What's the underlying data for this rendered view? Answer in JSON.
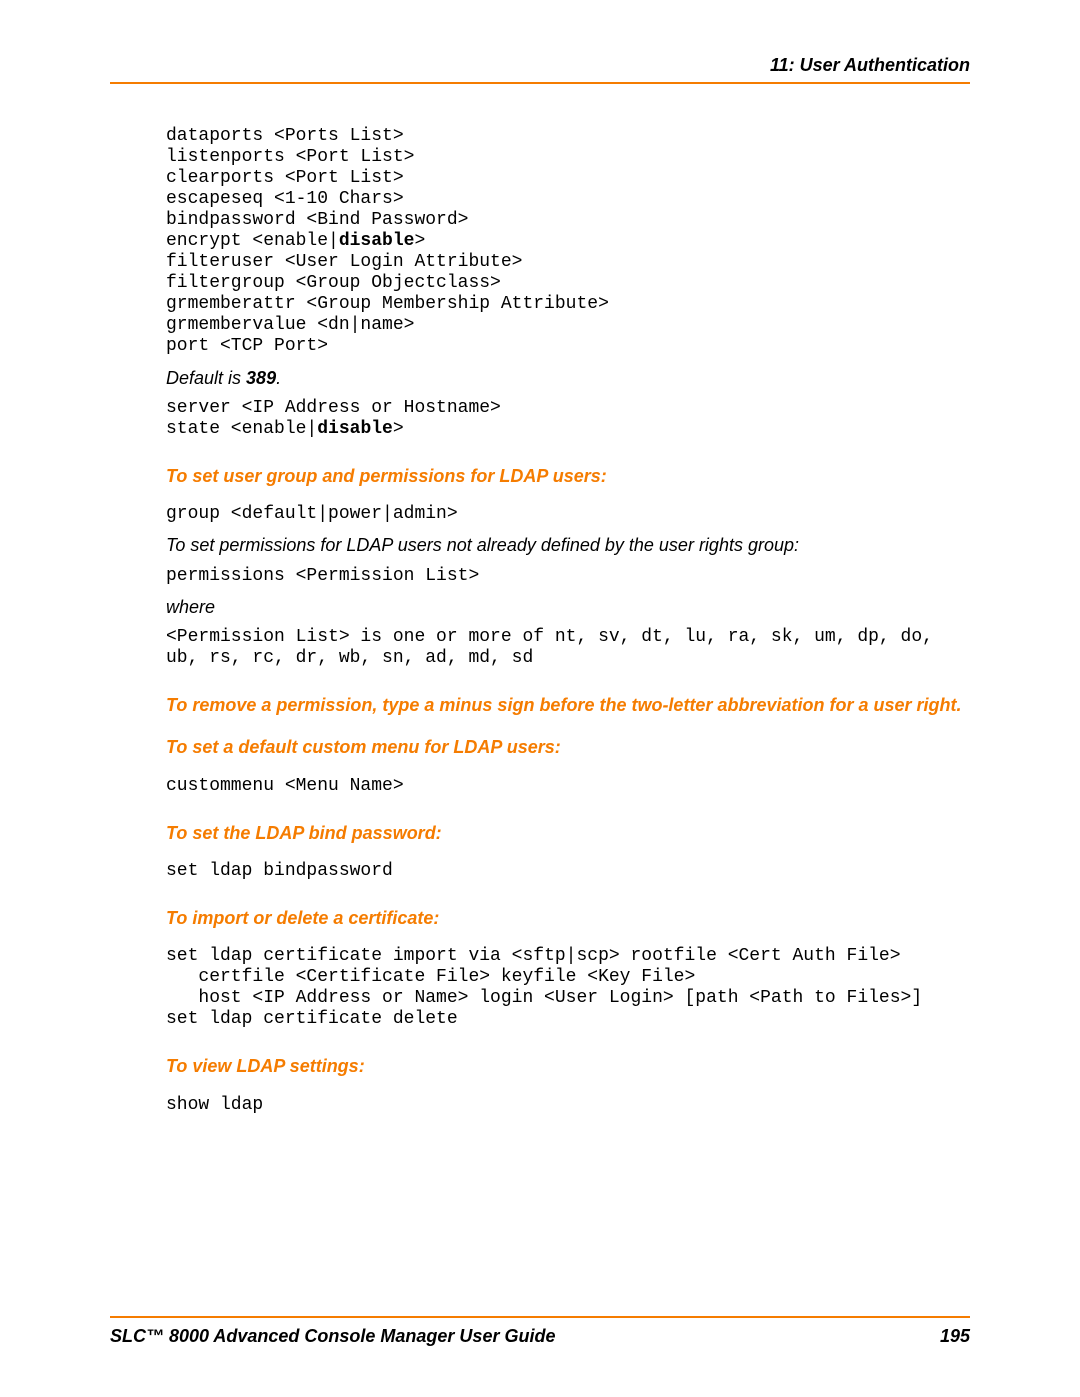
{
  "header": {
    "chapter": "11: User Authentication"
  },
  "code1_lines": [
    "dataports <Ports List>",
    "listenports <Port List>",
    "clearports <Port List>",
    "escapeseq <1-10 Chars>",
    "bindpassword <Bind Password>"
  ],
  "code1_encrypt_pre": "encrypt <enable|",
  "code1_encrypt_bold": "disable",
  "code1_encrypt_post": ">",
  "code1_tail": [
    "filteruser <User Login Attribute>",
    "filtergroup <Group Objectclass>",
    "grmemberattr <Group Membership Attribute>",
    "grmembervalue <dn|name>",
    "port <TCP Port>"
  ],
  "default_pre": "Default is ",
  "default_bold": "389",
  "default_post": ".",
  "code2_line1": "server <IP Address or Hostname>",
  "code2_state_pre": "state <enable|",
  "code2_state_bold": "disable",
  "code2_state_post": ">",
  "h_group": "To set user group and permissions for LDAP users:",
  "code_group": "group <default|power|admin>",
  "perm_note": "To set permissions for LDAP users not already defined by the user rights group:",
  "code_permissions": "permissions <Permission List>",
  "where": "where",
  "code_permlist": "<Permission List> is one or more of nt, sv, dt, lu, ra, sk, um, dp, do,\nub, rs, rc, dr, wb, sn, ad, md, sd",
  "h_remove": "To remove a permission, type a minus sign before the two-letter abbreviation for a user right.",
  "h_custommenu": "To set a default custom menu for LDAP users:",
  "code_custommenu": "custommenu <Menu Name>",
  "h_bindpw": "To set the LDAP bind password:",
  "code_bindpw": "set ldap bindpassword",
  "h_cert": "To import or delete a certificate:",
  "code_cert_pre": "set ldap certificate i",
  "code_cert_rest": "mport via <sftp|scp> rootfile <Cert Auth File>\n   certfile <Certificate File> keyfile <Key File>\n   host <IP Address or Name> login <User Login> [path <Path to Files>]\nset ldap certificate delete",
  "h_view": "To view LDAP settings:",
  "code_show": "show ldap",
  "footer": {
    "title": "SLC™ 8000 Advanced Console Manager User Guide",
    "page": "195"
  }
}
